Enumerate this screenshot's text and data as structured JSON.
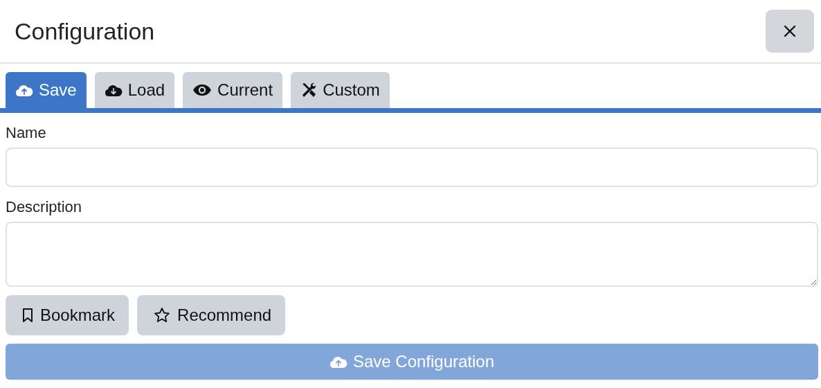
{
  "window": {
    "title": "Configuration"
  },
  "tabs": [
    {
      "label": "Save",
      "selected": true
    },
    {
      "label": "Load",
      "selected": false
    },
    {
      "label": "Current",
      "selected": false
    },
    {
      "label": "Custom",
      "selected": false
    }
  ],
  "fields": [
    {
      "label": "Name",
      "kind": "input"
    },
    {
      "label": "Description",
      "kind": "textarea"
    }
  ],
  "actions": [
    "Bookmark",
    "Recommend"
  ],
  "submit": {
    "label": "Save Configuration",
    "disabled": true
  }
}
